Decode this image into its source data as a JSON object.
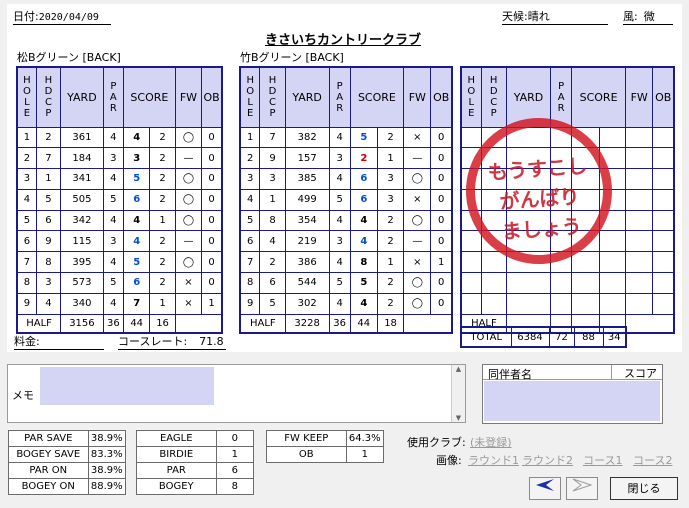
{
  "header": {
    "date_label": "日付:",
    "date": "2020/04/09",
    "course_name": "きさいちカントリークラブ",
    "weather_label": "天候:",
    "weather": "晴れ",
    "wind_label": "風:",
    "wind": "微"
  },
  "headers": {
    "hole": "HOLE",
    "hdcp": "HDCP",
    "yard": "YARD",
    "par": "PAR",
    "score": "SCORE",
    "fw": "FW",
    "ob": "OB"
  },
  "rounds": [
    {
      "title": "松Bグリーン [BACK]",
      "rows": [
        {
          "hole": "1",
          "hdcp": "2",
          "yard": "361",
          "par": "4",
          "score": "4",
          "putt": "2",
          "fw": "◯",
          "ob": "0"
        },
        {
          "hole": "2",
          "hdcp": "7",
          "yard": "184",
          "par": "3",
          "score": "3",
          "putt": "2",
          "fw": "—",
          "ob": "0"
        },
        {
          "hole": "3",
          "hdcp": "1",
          "yard": "341",
          "par": "4",
          "score": "5",
          "putt": "2",
          "fw": "◯",
          "ob": "0"
        },
        {
          "hole": "4",
          "hdcp": "5",
          "yard": "505",
          "par": "5",
          "score": "6",
          "putt": "2",
          "fw": "◯",
          "ob": "0"
        },
        {
          "hole": "5",
          "hdcp": "6",
          "yard": "342",
          "par": "4",
          "score": "4",
          "putt": "1",
          "fw": "◯",
          "ob": "0"
        },
        {
          "hole": "6",
          "hdcp": "9",
          "yard": "115",
          "par": "3",
          "score": "4",
          "putt": "2",
          "fw": "—",
          "ob": "0"
        },
        {
          "hole": "7",
          "hdcp": "8",
          "yard": "395",
          "par": "4",
          "score": "5",
          "putt": "2",
          "fw": "◯",
          "ob": "0"
        },
        {
          "hole": "8",
          "hdcp": "3",
          "yard": "573",
          "par": "5",
          "score": "6",
          "putt": "2",
          "fw": "×",
          "ob": "0"
        },
        {
          "hole": "9",
          "hdcp": "4",
          "yard": "340",
          "par": "4",
          "score": "7",
          "putt": "1",
          "fw": "×",
          "ob": "1"
        }
      ],
      "half": {
        "label": "HALF",
        "yard": "3156",
        "par": "36",
        "score": "44",
        "putt": "16"
      }
    },
    {
      "title": "竹Bグリーン [BACK]",
      "rows": [
        {
          "hole": "1",
          "hdcp": "7",
          "yard": "382",
          "par": "4",
          "score": "5",
          "putt": "2",
          "fw": "×",
          "ob": "0"
        },
        {
          "hole": "2",
          "hdcp": "9",
          "yard": "157",
          "par": "3",
          "score": "2",
          "putt": "1",
          "fw": "—",
          "ob": "0"
        },
        {
          "hole": "3",
          "hdcp": "3",
          "yard": "385",
          "par": "4",
          "score": "6",
          "putt": "3",
          "fw": "◯",
          "ob": "0"
        },
        {
          "hole": "4",
          "hdcp": "1",
          "yard": "499",
          "par": "5",
          "score": "6",
          "putt": "3",
          "fw": "×",
          "ob": "0"
        },
        {
          "hole": "5",
          "hdcp": "8",
          "yard": "354",
          "par": "4",
          "score": "4",
          "putt": "2",
          "fw": "◯",
          "ob": "0"
        },
        {
          "hole": "6",
          "hdcp": "4",
          "yard": "219",
          "par": "3",
          "score": "4",
          "putt": "2",
          "fw": "—",
          "ob": "0"
        },
        {
          "hole": "7",
          "hdcp": "2",
          "yard": "386",
          "par": "4",
          "score": "8",
          "putt": "1",
          "fw": "×",
          "ob": "1"
        },
        {
          "hole": "8",
          "hdcp": "6",
          "yard": "544",
          "par": "5",
          "score": "5",
          "putt": "2",
          "fw": "◯",
          "ob": "0"
        },
        {
          "hole": "9",
          "hdcp": "5",
          "yard": "302",
          "par": "4",
          "score": "4",
          "putt": "2",
          "fw": "◯",
          "ob": "0"
        }
      ],
      "half": {
        "label": "HALF",
        "yard": "3228",
        "par": "36",
        "score": "44",
        "putt": "18"
      }
    }
  ],
  "third": {
    "half_label": "HALF"
  },
  "total": {
    "label": "TOTAL",
    "yard": "6384",
    "par": "72",
    "score": "88",
    "putt": "34"
  },
  "stamp": {
    "line1": "もうすこし",
    "line2": "がんばり",
    "line3": "ましょう"
  },
  "fee": {
    "label": "料金:",
    "course_rate_label": "コースレート:",
    "course_rate": "71.8"
  },
  "memo": {
    "label": "メモ"
  },
  "companions": {
    "name_header": "同伴者名",
    "score_header": "スコア"
  },
  "stats": {
    "left": [
      {
        "label": "PAR SAVE",
        "value": "38.9%"
      },
      {
        "label": "BOGEY SAVE",
        "value": "83.3%"
      },
      {
        "label": "PAR ON",
        "value": "38.9%"
      },
      {
        "label": "BOGEY ON",
        "value": "88.9%"
      }
    ],
    "middle": [
      {
        "label": "EAGLE",
        "value": "0"
      },
      {
        "label": "BIRDIE",
        "value": "1"
      },
      {
        "label": "PAR",
        "value": "6"
      },
      {
        "label": "BOGEY",
        "value": "8"
      }
    ],
    "right": [
      {
        "label": "FW KEEP",
        "value": "64.3%"
      },
      {
        "label": "OB",
        "value": "1"
      }
    ]
  },
  "clubs": {
    "label": "使用クラブ:",
    "value": "(未登録)"
  },
  "images": {
    "label": "画像:",
    "links": [
      "ラウンド1",
      "ラウンド2",
      "コース1",
      "コース2"
    ]
  },
  "buttons": {
    "close": "閉じる"
  },
  "colors": {
    "grid": "#1a1a8a",
    "header_fill": "#d4d4f4",
    "birdie": "#d00000",
    "over_par": "#0050d0",
    "stamp": "#d2141e"
  }
}
